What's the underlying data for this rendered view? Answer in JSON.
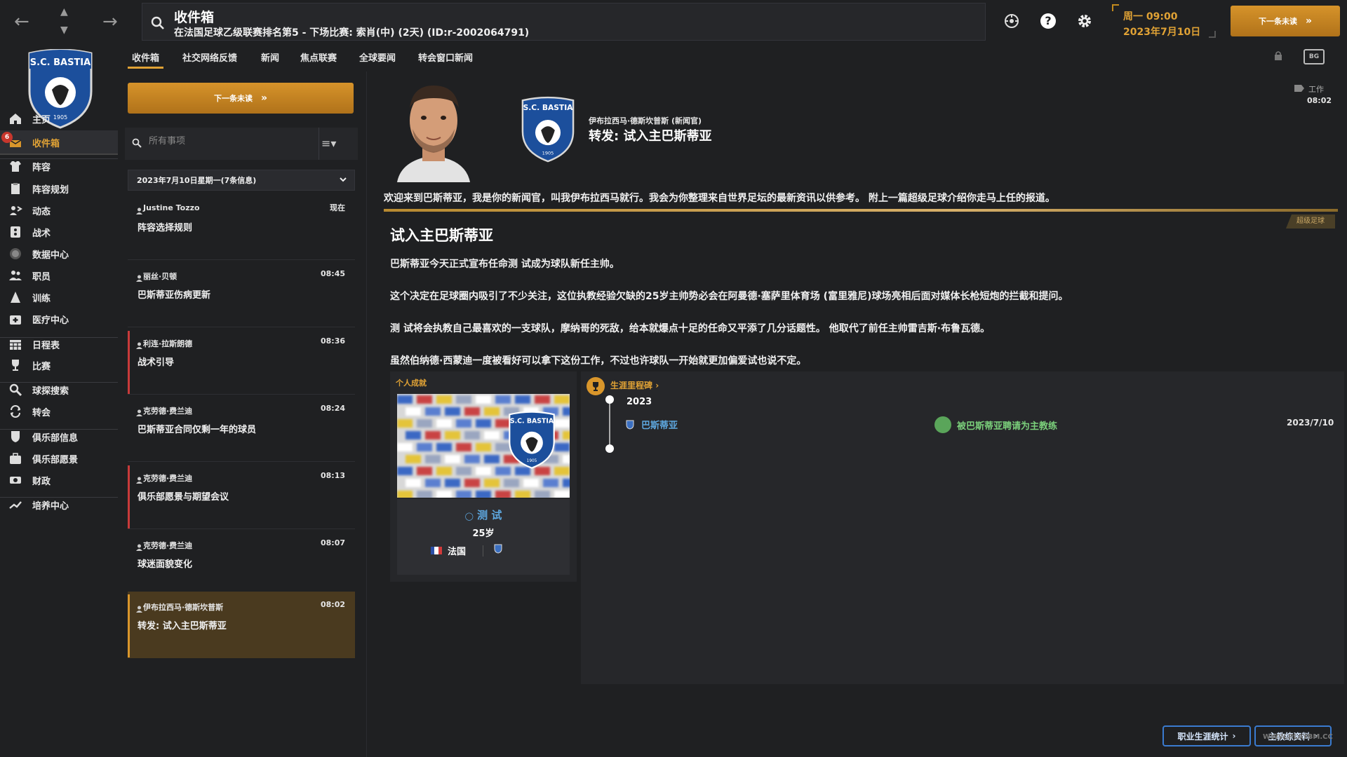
{
  "header": {
    "title": "收件箱",
    "subtitle": "在法国足球乙级联赛排名第5 - 下场比赛: 索肖(中) (2天) (ID:r-2002064791)",
    "time": "周一 09:00",
    "date": "2023年7月10日",
    "next_unread_label": "下一条未读"
  },
  "sidebar": {
    "club_name": "S.C. BASTIA",
    "crest_year": "1905",
    "inbox_badge": "6",
    "items": [
      {
        "label": "主页",
        "icon": "home-icon"
      },
      {
        "label": "收件箱",
        "icon": "inbox-icon"
      },
      {
        "label": "阵容",
        "icon": "shirt-icon"
      },
      {
        "label": "阵容规划",
        "icon": "clipboard-icon"
      },
      {
        "label": "动态",
        "icon": "dynamics-icon"
      },
      {
        "label": "战术",
        "icon": "tactics-icon"
      },
      {
        "label": "数据中心",
        "icon": "data-icon"
      },
      {
        "label": "职员",
        "icon": "staff-icon"
      },
      {
        "label": "训练",
        "icon": "training-icon"
      },
      {
        "label": "医疗中心",
        "icon": "medical-icon"
      },
      {
        "label": "日程表",
        "icon": "calendar-icon"
      },
      {
        "label": "比赛",
        "icon": "trophy-icon"
      },
      {
        "label": "球探搜索",
        "icon": "scout-icon"
      },
      {
        "label": "转会",
        "icon": "transfer-icon"
      },
      {
        "label": "俱乐部信息",
        "icon": "shield-icon"
      },
      {
        "label": "俱乐部愿景",
        "icon": "briefcase-icon"
      },
      {
        "label": "财政",
        "icon": "money-icon"
      },
      {
        "label": "培养中心",
        "icon": "development-icon"
      }
    ]
  },
  "tabs": [
    "收件箱",
    "社交网络反馈",
    "新闻",
    "焦点联赛",
    "全球要闻",
    "转会窗口新闻"
  ],
  "list": {
    "next_unread_label": "下一条未读",
    "filter_placeholder": "所有事项",
    "date_group": "2023年7月10日星期一(7条信息)",
    "messages": [
      {
        "sender": "Justine Tozzo",
        "time": "现在",
        "subject": "阵容选择规则"
      },
      {
        "sender": "丽丝·贝顿",
        "time": "08:45",
        "subject": "巴斯蒂亚伤病更新"
      },
      {
        "sender": "利连·拉斯朗德",
        "time": "08:36",
        "subject": "战术引导"
      },
      {
        "sender": "克劳德·费兰迪",
        "time": "08:24",
        "subject": "巴斯蒂亚合同仅剩一年的球员"
      },
      {
        "sender": "克劳德·费兰迪",
        "time": "08:13",
        "subject": "俱乐部愿景与期望会议"
      },
      {
        "sender": "克劳德·费兰迪",
        "time": "08:07",
        "subject": "球迷面貌变化"
      },
      {
        "sender": "伊布拉西马·德斯坎普斯",
        "time": "08:02",
        "subject": "转发:  试入主巴斯蒂亚"
      }
    ]
  },
  "detail": {
    "from": "伊布拉西马·德斯坎普斯 (新闻官)",
    "subject": "转发:  试入主巴斯蒂亚",
    "category": "工作",
    "time": "08:02",
    "layout_icon_text": "BG",
    "intro": "欢迎来到巴斯蒂亚，我是你的新闻官，叫我伊布拉西马就行。我会为你整理来自世界足坛的最新资讯以供参考。 附上一篇超级足球介绍你走马上任的报道。",
    "source_tag": "超级足球",
    "article_title": "试入主巴斯蒂亚",
    "paragraphs": [
      "巴斯蒂亚今天正式宣布任命测 试成为球队新任主帅。",
      "这个决定在足球圈内吸引了不少关注，这位执教经验欠缺的25岁主帅势必会在阿曼德·塞萨里体育场 (富里雅尼)球场亮相后面对媒体长枪短炮的拦截和提问。",
      "测 试将会执教自己最喜欢的一支球队，摩纳哥的死敌，给本就爆点十足的任命又平添了几分话题性。 他取代了前任主帅雷吉斯·布鲁瓦德。",
      "虽然伯纳德·西蒙迪一度被看好可以拿下这份工作，不过也许球队一开始就更加偏爱试也说不定。"
    ],
    "achievement": {
      "title": "个人成就",
      "name": "测 试",
      "age": "25岁",
      "nation": "法国"
    },
    "milestones": {
      "title": "生涯里程碑",
      "year": "2023",
      "club": "巴斯蒂亚",
      "event": "被巴斯蒂亚聘请为主教练",
      "date": "2023/7/10"
    },
    "buttons": {
      "career_stats": "职业生涯统计",
      "coach_profile": "主教练资料"
    }
  },
  "watermark": "WWW.PLAYBM.CC",
  "colors": {
    "accent": "#e0a235",
    "link": "#5ea8e0",
    "background": "#1f2022",
    "unread_marker": "#c83a3a"
  }
}
